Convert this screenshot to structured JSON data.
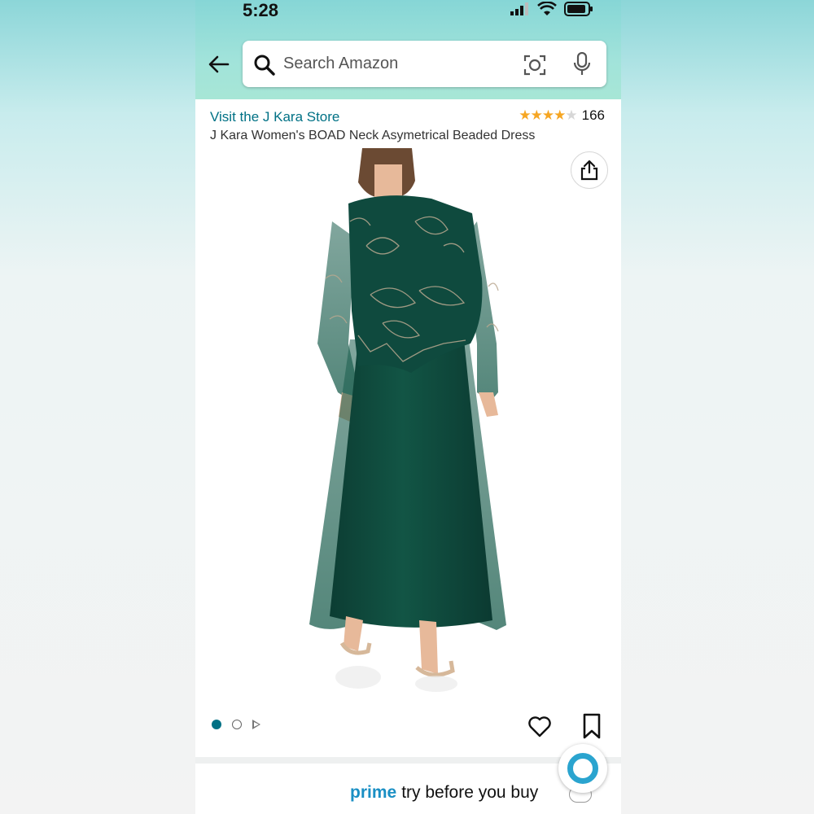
{
  "status_bar": {
    "time": "5:28"
  },
  "search": {
    "placeholder": "Search Amazon"
  },
  "product": {
    "store_link": "Visit the J Kara Store",
    "rating": 4.5,
    "review_count": "166",
    "title": "J Kara Women's BOAD Neck Asymetrical Beaded Dress"
  },
  "gallery": {
    "images_total": 2,
    "current_index": 1,
    "has_video": true
  },
  "prime": {
    "logo": "prime",
    "text": "try before you buy"
  },
  "icons": [
    "back-arrow-icon",
    "search-icon",
    "camera-lens-icon",
    "microphone-icon",
    "share-icon",
    "heart-icon",
    "bookmark-icon",
    "play-icon",
    "alexa-icon"
  ],
  "colors": {
    "link": "#007185",
    "star": "#f6a623",
    "prime": "#1a8fc4",
    "dress": "#0f4a3e"
  }
}
